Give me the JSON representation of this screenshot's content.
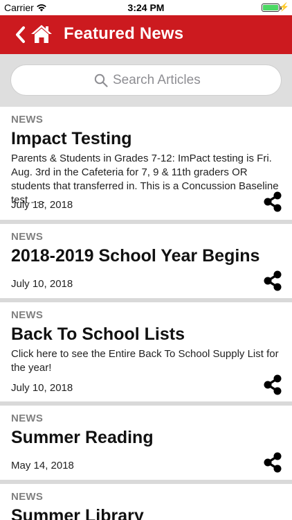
{
  "status_bar": {
    "carrier": "Carrier",
    "time": "3:24 PM"
  },
  "navbar": {
    "title": "Featured News"
  },
  "search": {
    "placeholder": "Search Articles"
  },
  "articles": [
    {
      "category": "NEWS",
      "title": "Impact Testing",
      "summary": "Parents & Students in Grades 7-12: ImPact testing is Fri. Aug. 3rd in the Cafeteria for 7, 9 & 11th graders OR students that transferred in. This is a Concussion Baseline test . . .",
      "date": "July 18, 2018"
    },
    {
      "category": "NEWS",
      "title": "2018-2019 School Year Begins",
      "summary": "",
      "date": "July 10, 2018"
    },
    {
      "category": "NEWS",
      "title": "Back To School Lists",
      "summary": "Click here to see the Entire Back To School Supply List for the year!",
      "date": "July 10, 2018"
    },
    {
      "category": "NEWS",
      "title": "Summer Reading",
      "summary": "",
      "date": "May 14, 2018"
    },
    {
      "category": "NEWS",
      "title": "Summer Library",
      "summary": "",
      "date": ""
    }
  ],
  "colors": {
    "navbar": "#cc1a1f",
    "background": "#d9d9d9",
    "battery": "#4cd964"
  },
  "icons": [
    "wifi-icon",
    "battery-icon",
    "back-chevron-icon",
    "home-icon",
    "search-icon",
    "share-icon"
  ]
}
